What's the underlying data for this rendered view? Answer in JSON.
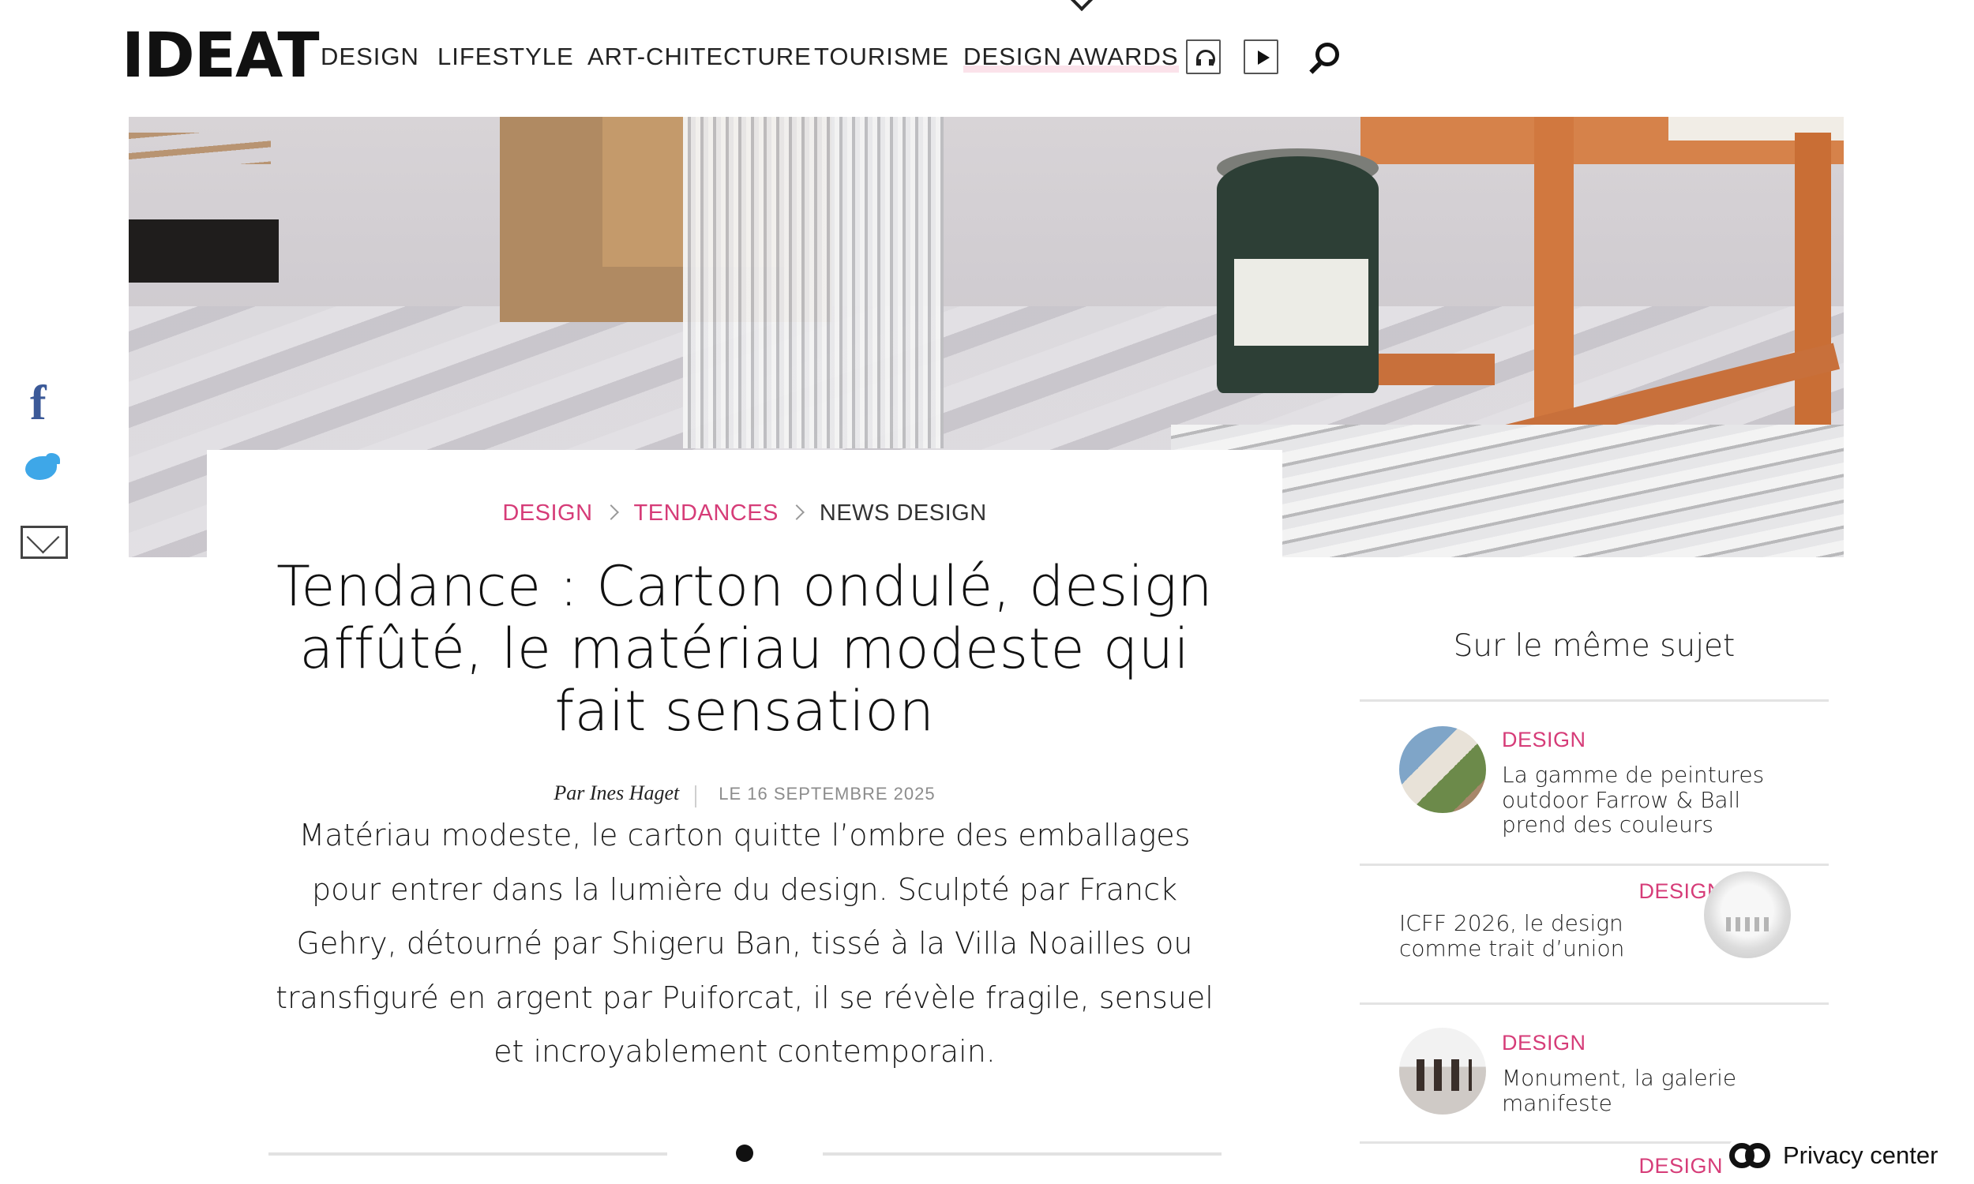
{
  "header": {
    "logo": "IDEAT",
    "nav": [
      {
        "label": "DESIGN"
      },
      {
        "label": "LIFESTYLE"
      },
      {
        "label": "ART-CHITECTURE"
      },
      {
        "label": "TOURISME"
      },
      {
        "label": "DESIGN AWARDS"
      }
    ],
    "icons": [
      "headphones-icon",
      "play-icon",
      "search-icon",
      "chevron-down-icon"
    ]
  },
  "share": {
    "icons": [
      "facebook-icon",
      "twitter-icon",
      "email-icon"
    ],
    "facebook_glyph": "f"
  },
  "article": {
    "breadcrumb": [
      "DESIGN",
      "TENDANCES",
      "NEWS DESIGN"
    ],
    "title": "Tendance : Carton ondulé, design affûté, le matériau modeste qui fait sensation",
    "author": "Par Ines Haget",
    "date": "LE 16 SEPTEMBRE 2025",
    "lead": "Matériau modeste, le carton quitte l’ombre des emballages pour entrer dans la lumière du design. Sculpté par Franck Gehry, détourné par Shigeru Ban, tissé à la Villa Noailles ou transfiguré en argent par Puiforcat, il se révèle fragile, sensuel et incroyablement contemporain."
  },
  "sidebar": {
    "heading": "Sur le même sujet",
    "items": [
      {
        "category": "DESIGN",
        "title": "La gamme de peintures outdoor Farrow & Ball prend des couleurs"
      },
      {
        "category": "DESIGN",
        "title": "ICFF 2026, le design comme trait d’union"
      },
      {
        "category": "DESIGN",
        "title": "Monument, la galerie manifeste"
      },
      {
        "category": "DESIGN",
        "title": ""
      }
    ]
  },
  "privacy": {
    "label": "Privacy center"
  },
  "colors": {
    "accent": "#d63c78",
    "text": "#1a1a1a",
    "muted": "#8c8c8c",
    "rule": "#e3e3e3"
  }
}
